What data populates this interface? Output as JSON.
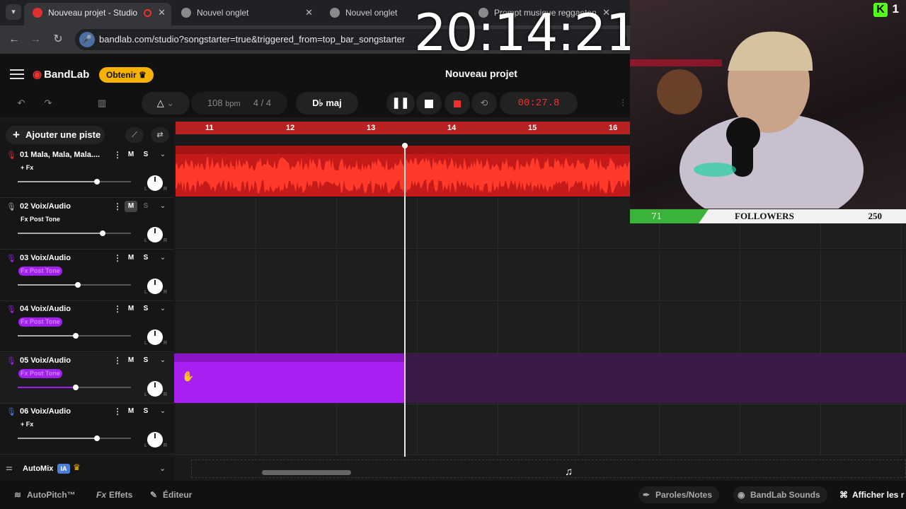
{
  "browser": {
    "tabs": [
      {
        "title": "Nouveau projet - Studio",
        "active": true
      },
      {
        "title": "Nouvel onglet",
        "active": false
      },
      {
        "title": "Nouvel onglet",
        "active": false
      },
      {
        "title": "Prompt musique reggaeton",
        "active": false
      }
    ],
    "url": "bandlab.com/studio?songstarter=true&triggered_from=top_bar_songstarter",
    "close_symbol": "✕"
  },
  "clock": "20:14:21",
  "header": {
    "logo": "BandLab",
    "obtenir": "Obtenir",
    "project_title": "Nouveau projet"
  },
  "transport": {
    "bpm_value": "108",
    "bpm_unit": "bpm",
    "time_signature": "4 / 4",
    "key": "D♭ maj",
    "time": "00:27.8"
  },
  "tracks_panel": {
    "add_track": "Ajouter une piste",
    "menu_dots": "⋮",
    "mute_label": "M",
    "solo_label": "S",
    "pan_l": "L",
    "pan_r": "R",
    "tracks": [
      {
        "name": "01  Mala, Mala, Mala....",
        "fx": "+ Fx",
        "volume": 0.7,
        "color": "#e03030",
        "mute_active": false,
        "fx_purple": false
      },
      {
        "name": "02  Voix/Audio",
        "fx": "Fx Post Tone",
        "volume": 0.75,
        "color": "#aaaaaa",
        "mute_active": true,
        "fx_purple": false
      },
      {
        "name": "03  Voix/Audio",
        "fx": "Fx Post Tone",
        "volume": 0.53,
        "color": "#a020f0",
        "mute_active": false,
        "fx_purple": true
      },
      {
        "name": "04  Voix/Audio",
        "fx": "Fx Post Tone",
        "volume": 0.51,
        "color": "#a020f0",
        "mute_active": false,
        "fx_purple": true
      },
      {
        "name": "05  Voix/Audio",
        "fx": "Fx Post Tone",
        "volume": 0.51,
        "color": "#a020f0",
        "mute_active": false,
        "fx_purple": true
      },
      {
        "name": "06  Voix/Audio",
        "fx": "+ Fx",
        "volume": 0.7,
        "color": "#4a7fd8",
        "mute_active": false,
        "fx_purple": false
      }
    ]
  },
  "ruler": {
    "marks": [
      "11",
      "12",
      "13",
      "14",
      "15",
      "16"
    ]
  },
  "automix": {
    "label": "AutoMix",
    "badge": "IA"
  },
  "bottom_bar": {
    "autopitch": "AutoPitch™",
    "effets": "Effets",
    "editeur": "Éditeur",
    "paroles": "Paroles/Notes",
    "sounds": "BandLab Sounds",
    "afficher": "Afficher les r"
  },
  "overlay": {
    "kick_count": "1",
    "followers_current": "71",
    "followers_label": "FOLLOWERS",
    "followers_goal": "250",
    "followers_progress": 0.284
  }
}
